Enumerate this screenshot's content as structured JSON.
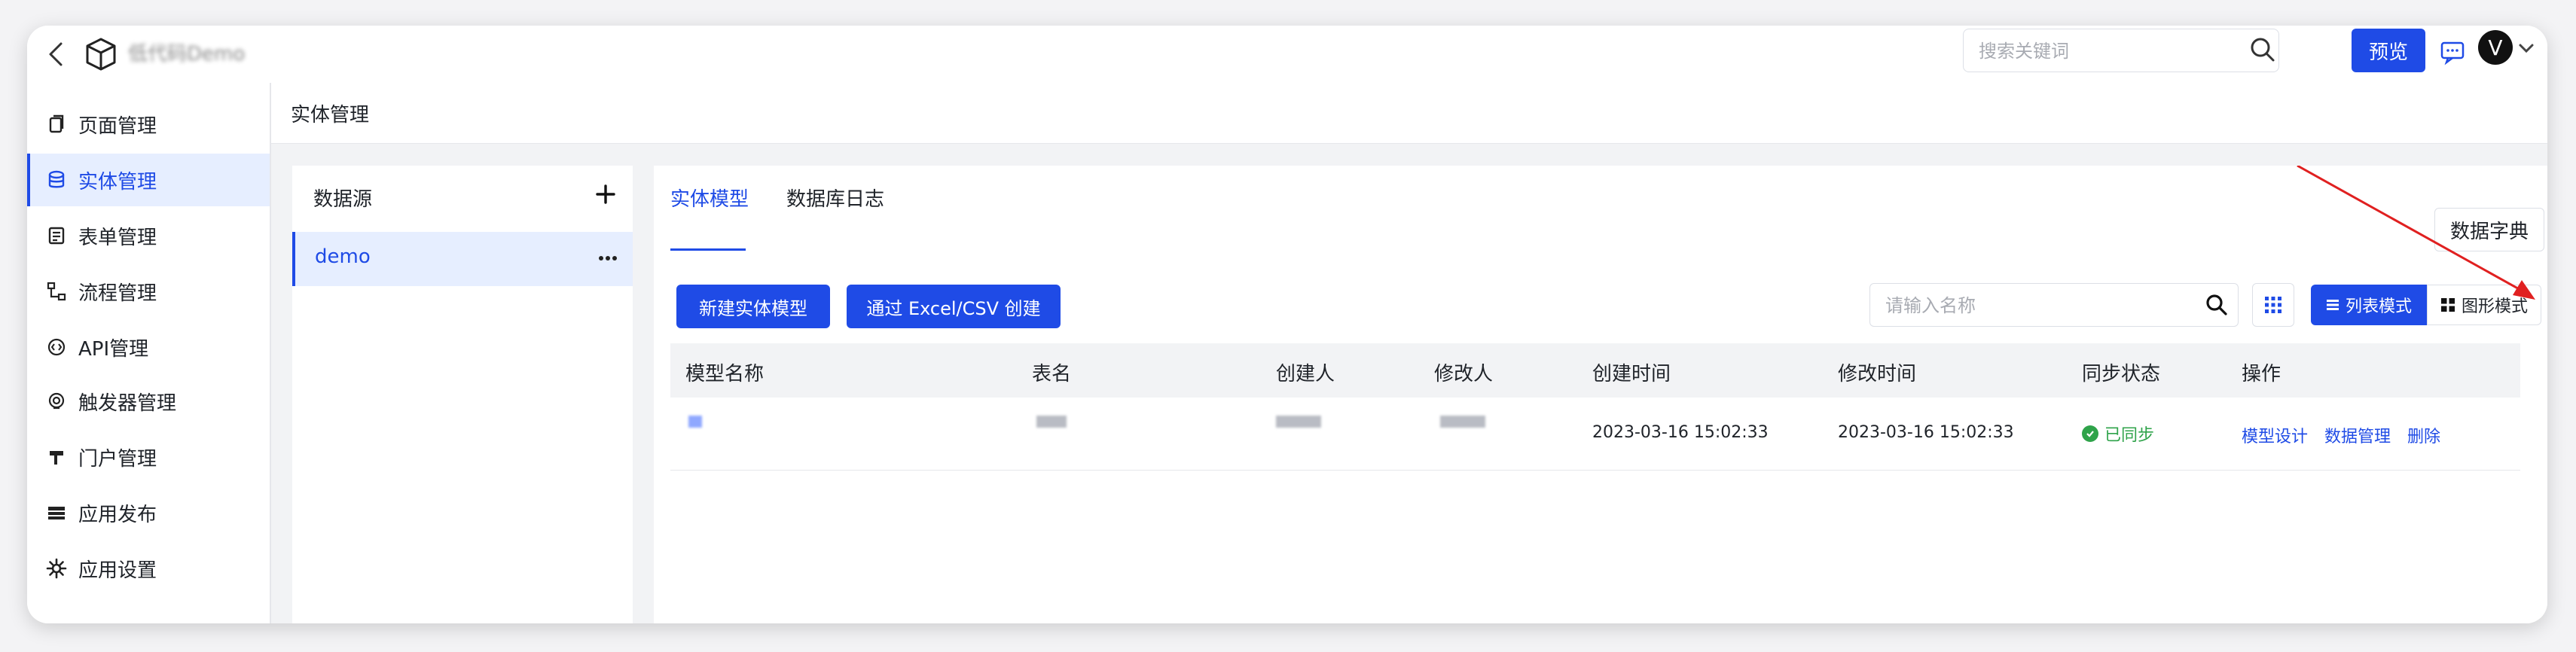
{
  "app": {
    "title": "低代码Demo"
  },
  "topbar": {
    "search_placeholder": "搜索关键词",
    "preview_label": "预览",
    "avatar_initial": "V"
  },
  "sidebar": {
    "items": [
      {
        "label": "页面管理",
        "icon": "page-icon"
      },
      {
        "label": "实体管理",
        "icon": "database-icon",
        "active": true
      },
      {
        "label": "表单管理",
        "icon": "form-icon"
      },
      {
        "label": "流程管理",
        "icon": "flow-icon"
      },
      {
        "label": "API管理",
        "icon": "api-icon"
      },
      {
        "label": "触发器管理",
        "icon": "trigger-icon"
      },
      {
        "label": "门户管理",
        "icon": "portal-icon"
      },
      {
        "label": "应用发布",
        "icon": "publish-icon"
      },
      {
        "label": "应用设置",
        "icon": "gear-icon"
      }
    ]
  },
  "page": {
    "title": "实体管理"
  },
  "datasource": {
    "title": "数据源",
    "items": [
      {
        "label": "demo"
      }
    ]
  },
  "main": {
    "tabs": [
      {
        "label": "实体模型",
        "active": true
      },
      {
        "label": "数据库日志"
      }
    ],
    "dict_button": "数据字典",
    "new_model_button": "新建实体模型",
    "import_button": "通过 Excel/CSV 创建",
    "name_search_placeholder": "请输入名称",
    "list_mode": "列表模式",
    "graph_mode": "图形模式",
    "table": {
      "columns": [
        "模型名称",
        "表名",
        "创建人",
        "修改人",
        "创建时间",
        "修改时间",
        "同步状态",
        "操作"
      ],
      "rows": [
        {
          "created_time": "2023-03-16 15:02:33",
          "modified_time": "2023-03-16 15:02:33",
          "sync_status": "已同步",
          "actions": [
            "模型设计",
            "数据管理",
            "删除"
          ]
        }
      ]
    }
  },
  "colors": {
    "accent": "#1f4be6",
    "success": "#2fa34a",
    "annotation_arrow": "#e02020"
  }
}
